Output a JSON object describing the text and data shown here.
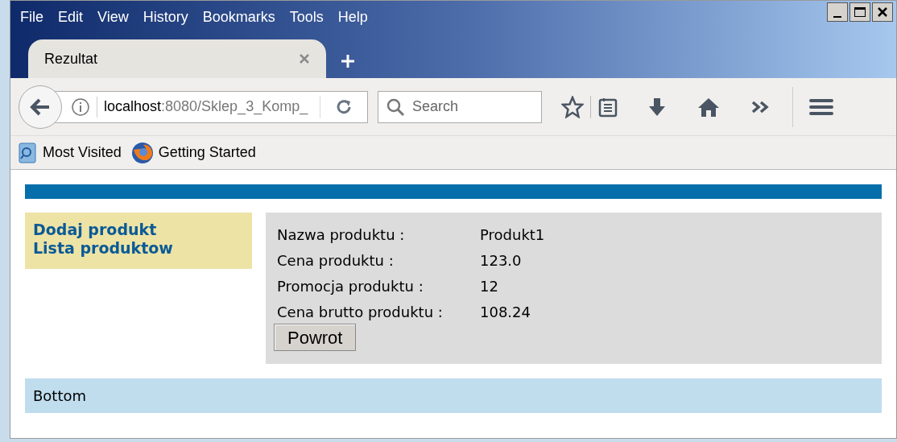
{
  "menu": [
    "File",
    "Edit",
    "View",
    "History",
    "Bookmarks",
    "Tools",
    "Help"
  ],
  "tabs": [
    {
      "label": "Rezultat",
      "selected": true
    }
  ],
  "address": {
    "host": "localhost",
    "path": ":8080/Sklep_3_Komp_"
  },
  "search": {
    "placeholder": "Search"
  },
  "bookmarks": [
    "Most Visited",
    "Getting Started"
  ],
  "sidebar": {
    "links": [
      "Dodaj produkt",
      "Lista produktow"
    ]
  },
  "details": [
    {
      "label": "Nazwa produktu :",
      "value": "Produkt1"
    },
    {
      "label": "Cena produktu :",
      "value": "123.0"
    },
    {
      "label": "Promocja produktu :",
      "value": "12"
    },
    {
      "label": "Cena brutto produktu :",
      "value": "108.24"
    }
  ],
  "back_button": "Powrot",
  "footer": "Bottom"
}
